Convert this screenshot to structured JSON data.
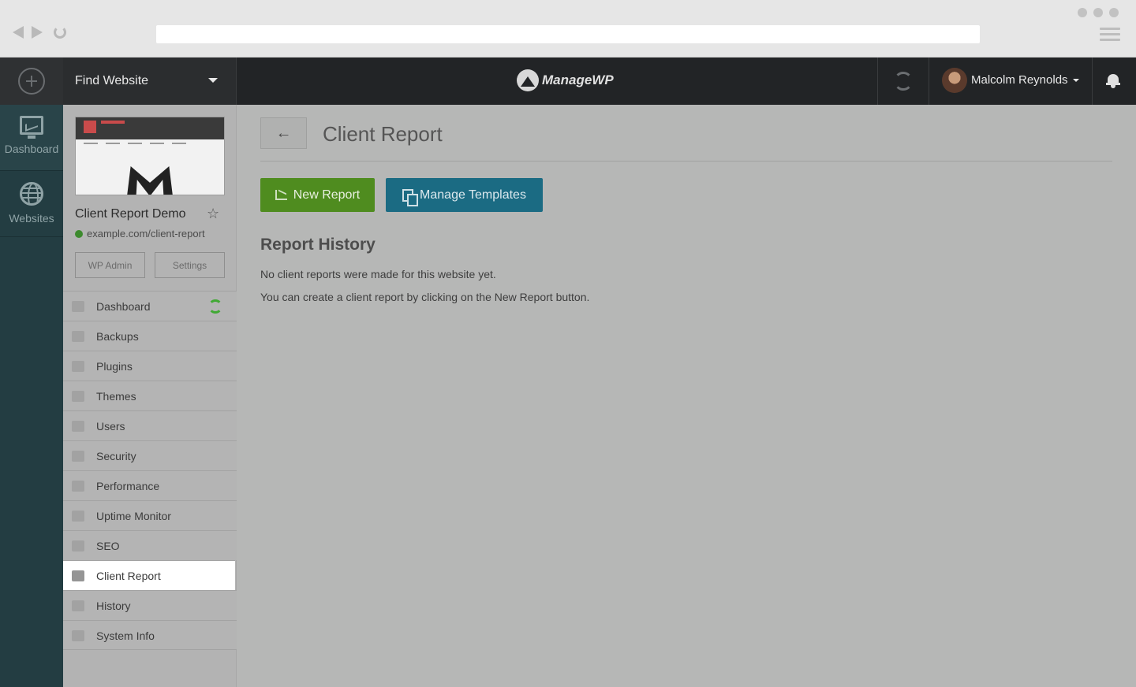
{
  "header": {
    "find_website_label": "Find Website",
    "brand_name": "ManageWP",
    "user_name": "Malcolm Reynolds"
  },
  "rail": {
    "items": [
      {
        "label": "Dashboard",
        "icon": "dashboard-monitor-icon"
      },
      {
        "label": "Websites",
        "icon": "globe-icon"
      }
    ]
  },
  "site": {
    "title": "Client Report Demo",
    "url": "example.com/client-report",
    "wp_admin_label": "WP Admin",
    "settings_label": "Settings",
    "menu": [
      {
        "label": "Dashboard",
        "icon": "monitor-icon"
      },
      {
        "label": "Backups",
        "icon": "backup-icon"
      },
      {
        "label": "Plugins",
        "icon": "plug-icon"
      },
      {
        "label": "Themes",
        "icon": "palette-icon"
      },
      {
        "label": "Users",
        "icon": "user-icon"
      },
      {
        "label": "Security",
        "icon": "shield-icon"
      },
      {
        "label": "Performance",
        "icon": "gauge-icon"
      },
      {
        "label": "Uptime Monitor",
        "icon": "arrow-up-icon"
      },
      {
        "label": "SEO",
        "icon": "megaphone-icon"
      },
      {
        "label": "Client Report",
        "icon": "chart-icon",
        "active": true
      },
      {
        "label": "History",
        "icon": "clock-icon"
      },
      {
        "label": "System Info",
        "icon": "server-icon"
      }
    ]
  },
  "main": {
    "page_title": "Client Report",
    "back_label": "←",
    "new_report_label": "New Report",
    "manage_templates_label": "Manage Templates",
    "section_title": "Report History",
    "empty_message_1": "No client reports were made for this website yet.",
    "empty_message_2": "You can create a client report by clicking on the New Report button."
  },
  "colors": {
    "new_report": "#4f8c1f",
    "manage_templates": "#1b6b83",
    "rail": "#233d42",
    "topbar": "#222426",
    "status_online": "#3d8a2e",
    "sync_active": "#41a934"
  }
}
